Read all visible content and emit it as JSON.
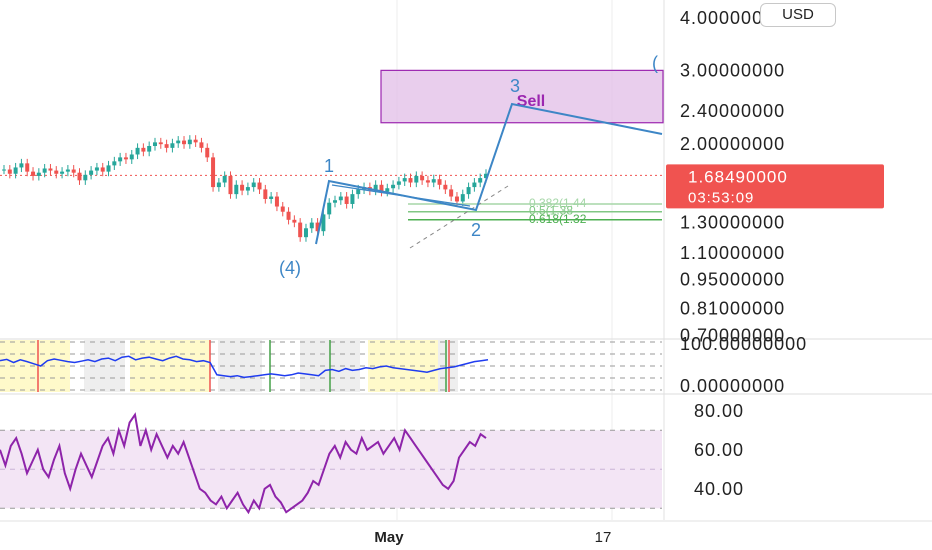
{
  "currency": "USD",
  "chart_data": [
    {
      "type": "candlestick",
      "scale": "log",
      "price_axis_labels": [
        "4.00000000",
        "3.00000000",
        "2.40000000",
        "2.00000000",
        "1.30000000",
        "1.10000000",
        "0.95000000",
        "0.81000000",
        "0.70000000"
      ],
      "price_axis_values": [
        4.0,
        3.0,
        2.4,
        2.0,
        1.3,
        1.1,
        0.95,
        0.81,
        0.7
      ],
      "ylim": [
        0.68,
        4.3
      ],
      "last_price": {
        "label": "1.68490000",
        "countdown": "03:53:09",
        "value": 1.6849,
        "color": "#f05350"
      },
      "time_axis_labels": [
        "May",
        "17"
      ],
      "wave_labels": [
        "1",
        "(4)",
        "3",
        "2",
        "("
      ],
      "zone": {
        "label": "Sell",
        "top": 3.0,
        "bottom": 2.25,
        "color": "#9c27b0"
      },
      "fib_labels": [
        "0.382(1.44",
        "0.5(1.38",
        "0.618(1.32"
      ],
      "fib_values": [
        1.44,
        1.38,
        1.32
      ],
      "close_series": [
        1.74,
        1.7,
        1.76,
        1.8,
        1.72,
        1.68,
        1.71,
        1.75,
        1.73,
        1.7,
        1.72,
        1.74,
        1.71,
        1.64,
        1.69,
        1.73,
        1.76,
        1.72,
        1.78,
        1.82,
        1.86,
        1.84,
        1.89,
        1.96,
        1.92,
        1.98,
        2.02,
        2.0,
        1.96,
        2.01,
        2.04,
        2.0,
        2.05,
        2.02,
        1.96,
        1.86,
        1.58,
        1.62,
        1.68,
        1.52,
        1.6,
        1.55,
        1.58,
        1.62,
        1.56,
        1.48,
        1.5,
        1.42,
        1.38,
        1.32,
        1.3,
        1.2,
        1.26,
        1.3,
        1.24,
        1.36,
        1.45,
        1.47,
        1.5,
        1.44,
        1.52,
        1.56,
        1.58,
        1.55,
        1.6,
        1.54,
        1.57,
        1.6,
        1.63,
        1.66,
        1.62,
        1.68,
        1.64,
        1.62,
        1.65,
        1.6,
        1.56,
        1.5,
        1.46,
        1.52,
        1.58,
        1.62,
        1.66,
        1.7
      ]
    },
    {
      "type": "line",
      "name": "indicator",
      "y_axis_labels": [
        "100.00000000",
        "0.00000000"
      ],
      "ylim": [
        0,
        100
      ],
      "values": [
        62,
        65,
        58,
        64,
        60,
        55,
        50,
        62,
        66,
        63,
        60,
        58,
        61,
        64,
        60,
        66,
        68,
        62,
        70,
        72,
        64,
        68,
        70,
        66,
        62,
        68,
        72,
        66,
        64,
        60,
        62,
        58,
        30,
        28,
        26,
        28,
        24,
        26,
        28,
        30,
        32,
        30,
        28,
        30,
        34,
        32,
        30,
        28,
        40,
        42,
        38,
        44,
        40,
        42,
        46,
        44,
        48,
        50,
        46,
        44,
        42,
        40,
        38,
        36,
        40,
        44,
        46,
        48,
        52,
        56,
        60,
        62,
        64
      ],
      "color": "#1f3cf0"
    },
    {
      "type": "line",
      "name": "RSI",
      "y_axis_labels": [
        "80.00",
        "60.00",
        "40.00"
      ],
      "y_axis_values": [
        80,
        60,
        40
      ],
      "ylim": [
        24,
        84
      ],
      "band": [
        30,
        70
      ],
      "values": [
        60,
        52,
        62,
        66,
        58,
        48,
        54,
        60,
        50,
        46,
        55,
        62,
        48,
        40,
        50,
        58,
        52,
        46,
        54,
        62,
        66,
        58,
        70,
        62,
        74,
        78,
        62,
        70,
        60,
        68,
        62,
        56,
        62,
        58,
        64,
        56,
        48,
        40,
        38,
        34,
        32,
        36,
        30,
        34,
        38,
        32,
        28,
        34,
        30,
        40,
        42,
        36,
        33,
        28,
        30,
        32,
        34,
        38,
        44,
        42,
        50,
        58,
        62,
        56,
        64,
        60,
        58,
        66,
        60,
        62,
        64,
        58,
        62,
        66,
        60,
        70,
        66,
        62,
        58,
        54,
        50,
        46,
        42,
        40,
        44,
        56,
        60,
        64,
        62,
        68,
        66
      ],
      "color": "#8e24aa"
    }
  ]
}
